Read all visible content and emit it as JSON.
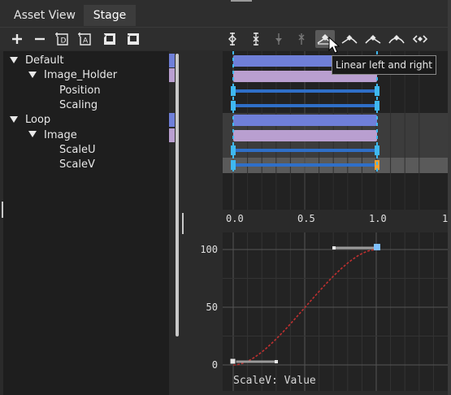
{
  "tabs": [
    {
      "label": "Asset View",
      "active": false
    },
    {
      "label": "Stage",
      "active": true
    }
  ],
  "toolbar_left": [
    {
      "icon": "plus-icon"
    },
    {
      "icon": "minus-icon"
    },
    {
      "icon": "add-d-icon"
    },
    {
      "icon": "add-a-icon"
    },
    {
      "icon": "film-add-icon"
    },
    {
      "icon": "film-remove-icon"
    }
  ],
  "toolbar_right": [
    {
      "icon": "key-add-icon"
    },
    {
      "icon": "key-remove-icon"
    },
    {
      "icon": "key-next-icon"
    },
    {
      "icon": "key-prev-icon"
    },
    {
      "icon": "linear-left-right-icon",
      "active": true
    },
    {
      "icon": "linear-left-icon"
    },
    {
      "icon": "linear-right-icon"
    },
    {
      "icon": "smooth-icon"
    },
    {
      "icon": "step-icon"
    }
  ],
  "tooltip": "Linear left and right",
  "tree": [
    {
      "label": "Default",
      "level": 0,
      "expander": true,
      "color": "#6f7fd8"
    },
    {
      "label": "Image_Holder",
      "level": 1,
      "expander": true,
      "color": "#b99fd0"
    },
    {
      "label": "Position",
      "level": 2,
      "expander": false,
      "color": null
    },
    {
      "label": "Scaling",
      "level": 2,
      "expander": false,
      "color": null
    },
    {
      "label": "Loop",
      "level": 0,
      "expander": true,
      "color": "#6f7fd8"
    },
    {
      "label": "Image",
      "level": 1,
      "expander": true,
      "color": "#b99fd0"
    },
    {
      "label": "ScaleU",
      "level": 2,
      "expander": false,
      "color": null
    },
    {
      "label": "ScaleV",
      "level": 2,
      "expander": false,
      "color": null
    }
  ],
  "timeline": {
    "ruler_labels": [
      "0.0",
      "0.5",
      "1.0",
      "1"
    ],
    "colors": {
      "blue": "#6f7fd8",
      "purple": "#b99fd0",
      "key": "#3fb8f0",
      "key_selected": "#f0a030",
      "track": "#2f6fc8"
    }
  },
  "curve_editor": {
    "y_labels": [
      "100",
      "50",
      "0"
    ],
    "caption": "ScaleV: Value",
    "curve_color": "#c03030"
  }
}
